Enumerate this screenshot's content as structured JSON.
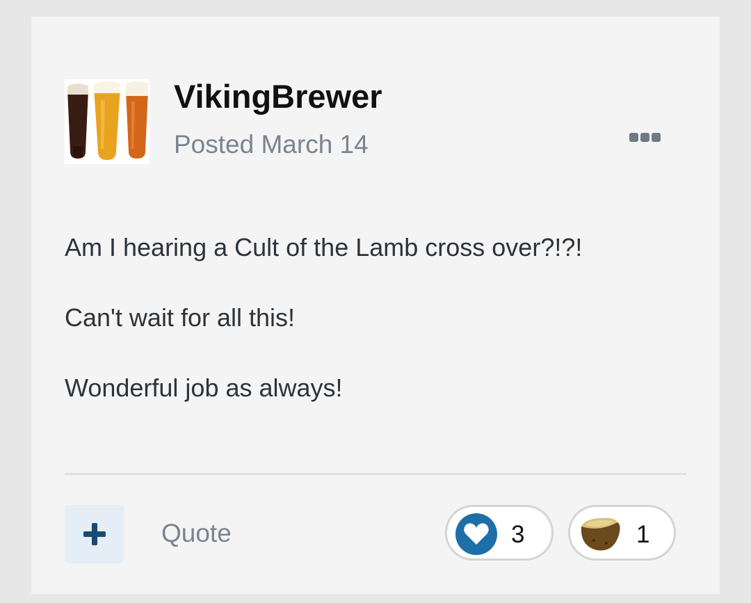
{
  "post": {
    "author": "VikingBrewer",
    "posted_label": "Posted March 14",
    "avatar_icon": "beer-glasses-avatar",
    "body": [
      "Am I hearing a Cult of the Lamb cross over?!?!",
      "Can't wait for all this!",
      "Wonderful job as always!"
    ]
  },
  "actions": {
    "more_icon": "ellipsis-icon",
    "plus_icon": "plus-icon",
    "quote_label": "Quote"
  },
  "reactions": [
    {
      "type": "like",
      "icon": "heart-icon",
      "count": "3",
      "color": "#1e6fa8"
    },
    {
      "type": "potato",
      "icon": "potato-icon",
      "count": "1"
    }
  ]
}
